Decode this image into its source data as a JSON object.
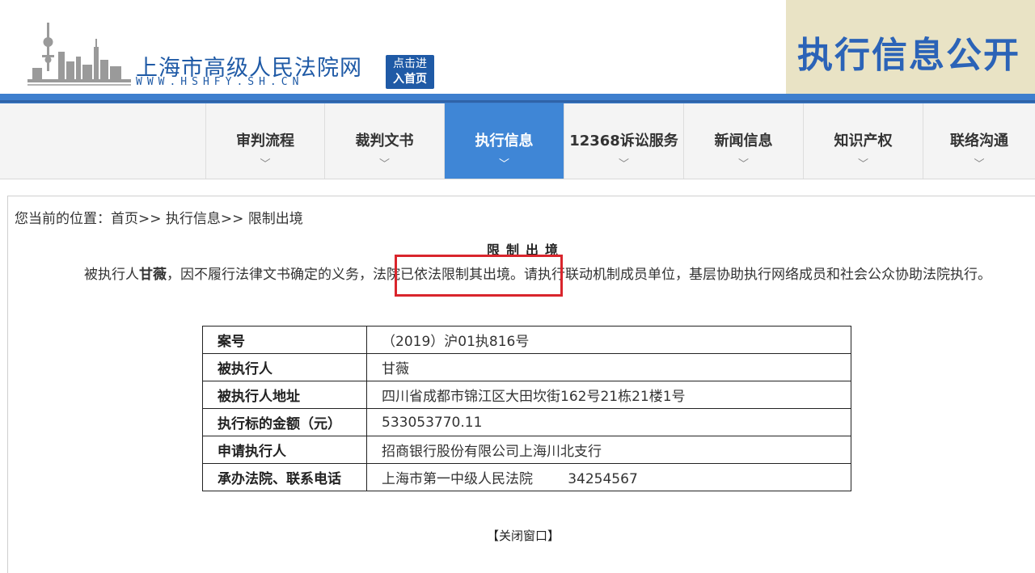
{
  "header": {
    "site_title": "上海市高级人民法院网",
    "site_url": "WWW.HSHFY.SH.CN",
    "enter_line1": "点击进",
    "enter_line2": "入首页",
    "banner_text": "执行信息公开"
  },
  "nav": {
    "items": [
      {
        "label": "审判流程",
        "chev": "﹀"
      },
      {
        "label": "裁判文书",
        "chev": "﹀"
      },
      {
        "label": "执行信息",
        "chev": "﹀"
      },
      {
        "label": "12368诉讼服务",
        "chev": "﹀"
      },
      {
        "label": "新闻信息",
        "chev": "﹀"
      },
      {
        "label": "知识产权",
        "chev": "﹀"
      },
      {
        "label": "联络沟通",
        "chev": "﹀"
      }
    ],
    "active_index": 2
  },
  "breadcrumb": {
    "prefix": "您当前的位置：",
    "home": "首页",
    "sep": ">>",
    "section": "执行信息",
    "current": "限制出境"
  },
  "notice": {
    "title": "限制出境",
    "text_before": "被执行人",
    "name": "甘薇",
    "text_mid": "，因不履行法律文书确定的义务，",
    "highlight": "法院已依法限制其出境",
    "text_after": "。请执行联动机制成员单位，基层协助执行网络成员和社会公众协助法院执行。"
  },
  "table": {
    "rows": [
      {
        "k": "案号",
        "v": "（2019）沪01执816号"
      },
      {
        "k": "被执行人",
        "v": "甘薇"
      },
      {
        "k": "被执行人地址",
        "v": "四川省成都市锦江区大田坎街162号21栋21楼1号"
      },
      {
        "k": "执行标的金额（元）",
        "v": "533053770.11"
      },
      {
        "k": "申请执行人",
        "v": "招商银行股份有限公司上海川北支行"
      },
      {
        "k": "承办法院、联系电话",
        "v": "上海市第一中级人民法院        34254567"
      }
    ]
  },
  "footer": {
    "close_label": "【关闭窗口】"
  },
  "colors": {
    "brand_blue": "#1f5aa6",
    "nav_active": "#3f86d6",
    "highlight_red": "#d9252c",
    "banner_bg": "#e9e3c5"
  }
}
